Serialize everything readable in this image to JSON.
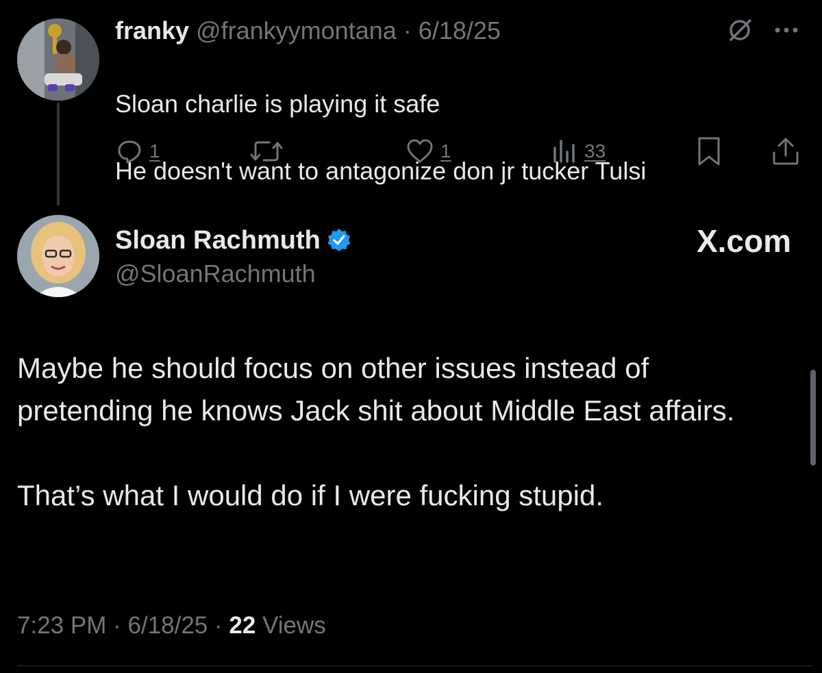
{
  "reply_tweet": {
    "display_name": "franky",
    "handle": "@frankyymontana",
    "separator": "·",
    "date": "6/18/25",
    "text_line_1": "Sloan charlie is playing it safe",
    "text_line_2": "He doesn't want to antagonize don jr tucker Tulsi",
    "avatar_icon": "user-avatar-photo",
    "actions": {
      "reply_count": "1",
      "retweet_count": "",
      "like_count": "1",
      "views_count": "33"
    }
  },
  "main_tweet": {
    "display_name": "Sloan Rachmuth",
    "handle": "@SloanRachmuth",
    "verified": true,
    "verified_color": "#1d9bf0",
    "brand_label": "X.com",
    "body_paragraph_1": "Maybe he should focus on other issues instead of pretending he knows Jack shit about Middle East affairs.",
    "body_paragraph_2": "That’s what I would do if I were fucking stupid.",
    "time": "7:23 PM",
    "separator": "·",
    "date": "6/18/25",
    "views_count": "22",
    "views_label": "Views"
  },
  "colors": {
    "background": "#000000",
    "primary_text": "#e7e9ea",
    "secondary_text": "#71767b",
    "accent": "#1d9bf0"
  }
}
